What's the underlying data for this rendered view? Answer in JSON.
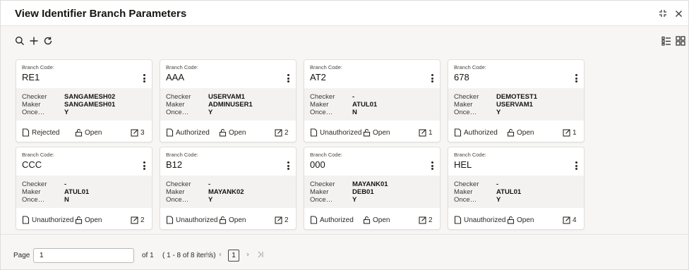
{
  "header": {
    "title": "View Identifier Branch Parameters",
    "maximize_icon": "expand-icon",
    "close_icon": "close-icon"
  },
  "toolbar": {
    "search_icon": "search-icon",
    "add_icon": "plus-icon",
    "refresh_icon": "refresh-icon",
    "list_view_icon": "list-view-icon",
    "tile_view_icon": "tile-view-icon"
  },
  "labels": {
    "branch_code": "Branch Code:",
    "checker": "Checker",
    "maker": "Maker",
    "once": "Once…",
    "open": "Open"
  },
  "cards": [
    {
      "code": "RE1",
      "checker": "SANGAMESH02",
      "maker": "SANGAMESH01",
      "once": "Y",
      "status": "Rejected",
      "lock": "Open",
      "edits": "3"
    },
    {
      "code": "AAA",
      "checker": "USERVAM1",
      "maker": "ADMINUSER1",
      "once": "Y",
      "status": "Authorized",
      "lock": "Open",
      "edits": "2"
    },
    {
      "code": "AT2",
      "checker": "-",
      "maker": "ATUL01",
      "once": "N",
      "status": "Unauthorized",
      "lock": "Open",
      "edits": "1"
    },
    {
      "code": "678",
      "checker": "DEMOTEST1",
      "maker": "USERVAM1",
      "once": "Y",
      "status": "Authorized",
      "lock": "Open",
      "edits": "1"
    },
    {
      "code": "CCC",
      "checker": "-",
      "maker": "ATUL01",
      "once": "N",
      "status": "Unauthorized",
      "lock": "Open",
      "edits": "2"
    },
    {
      "code": "B12",
      "checker": "-",
      "maker": "MAYANK02",
      "once": "Y",
      "status": "Unauthorized",
      "lock": "Open",
      "edits": "2"
    },
    {
      "code": "000",
      "checker": "MAYANK01",
      "maker": "DEB01",
      "once": "Y",
      "status": "Authorized",
      "lock": "Open",
      "edits": "2"
    },
    {
      "code": "HEL",
      "checker": "-",
      "maker": "ATUL01",
      "once": "Y",
      "status": "Unauthorized",
      "lock": "Open",
      "edits": "4"
    }
  ],
  "pagination": {
    "page_label": "Page",
    "page_value": "1",
    "of_label": "of 1",
    "items_label": "( 1 - 8 of 8 items)",
    "current_page": "1",
    "first_icon": "first-page-icon",
    "prev_icon": "prev-page-icon",
    "next_icon": "next-page-icon",
    "last_icon": "last-page-icon"
  },
  "colors": {
    "background": "#f7f6f4",
    "card": "#ffffff",
    "card_body": "#f3f2f0",
    "text": "#161513"
  }
}
